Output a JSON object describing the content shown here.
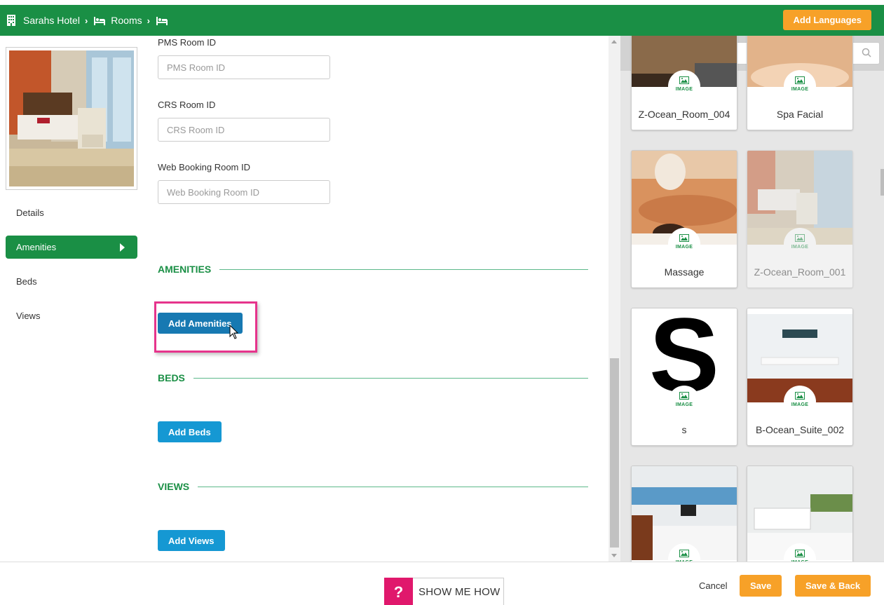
{
  "header": {
    "breadcrumb": [
      {
        "label": "Sarahs Hotel",
        "icon": "building-icon"
      },
      {
        "label": "Rooms",
        "icon": "bed-icon"
      },
      {
        "label": "",
        "icon": "bed-icon"
      }
    ],
    "add_languages_label": "Add Languages"
  },
  "sidebar": {
    "items": [
      {
        "label": "Details",
        "active": false
      },
      {
        "label": "Amenities",
        "active": true
      },
      {
        "label": "Beds",
        "active": false
      },
      {
        "label": "Views",
        "active": false
      }
    ]
  },
  "form": {
    "pms": {
      "label": "PMS Room ID",
      "placeholder": "PMS Room ID",
      "value": ""
    },
    "crs": {
      "label": "CRS Room ID",
      "placeholder": "CRS Room ID",
      "value": ""
    },
    "web": {
      "label": "Web Booking Room ID",
      "placeholder": "Web Booking Room ID",
      "value": ""
    }
  },
  "sections": {
    "amenities": {
      "title": "AMENITIES",
      "button": "Add Amenities"
    },
    "beds": {
      "title": "BEDS",
      "button": "Add Beds"
    },
    "views": {
      "title": "VIEWS",
      "button": "Add Views"
    }
  },
  "media": {
    "search_placeholder": "Search",
    "badge_label": "IMAGE",
    "cards": [
      {
        "name": "Z-Ocean_Room_004"
      },
      {
        "name": "Spa Facial"
      },
      {
        "name": "Massage"
      },
      {
        "name": "Z-Ocean_Room_001"
      },
      {
        "name": "s"
      },
      {
        "name": "B-Ocean_Suite_002"
      },
      {
        "name": ""
      },
      {
        "name": ""
      }
    ]
  },
  "footer": {
    "show_me_how": "SHOW ME HOW",
    "help_glyph": "?",
    "cancel": "Cancel",
    "save": "Save",
    "save_back": "Save & Back"
  },
  "colors": {
    "brand_green": "#1a8f45",
    "accent_orange": "#f7a128",
    "button_blue": "#1598d3",
    "highlight_pink": "#e6348c"
  }
}
